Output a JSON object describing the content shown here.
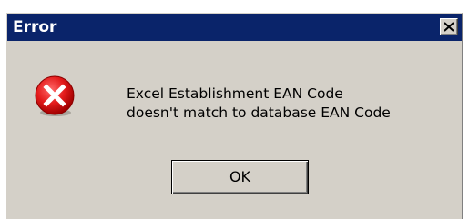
{
  "dialog": {
    "title": "Error",
    "message_lines": [
      "Excel Establishment EAN Code",
      "doesn't match to database EAN Code"
    ],
    "ok_label": "OK",
    "icon": "error-icon",
    "close_icon": "close-icon"
  },
  "colors": {
    "titlebar": "#0a246a",
    "dialog_bg": "#d4d0c8",
    "error_red": "#e02020"
  }
}
